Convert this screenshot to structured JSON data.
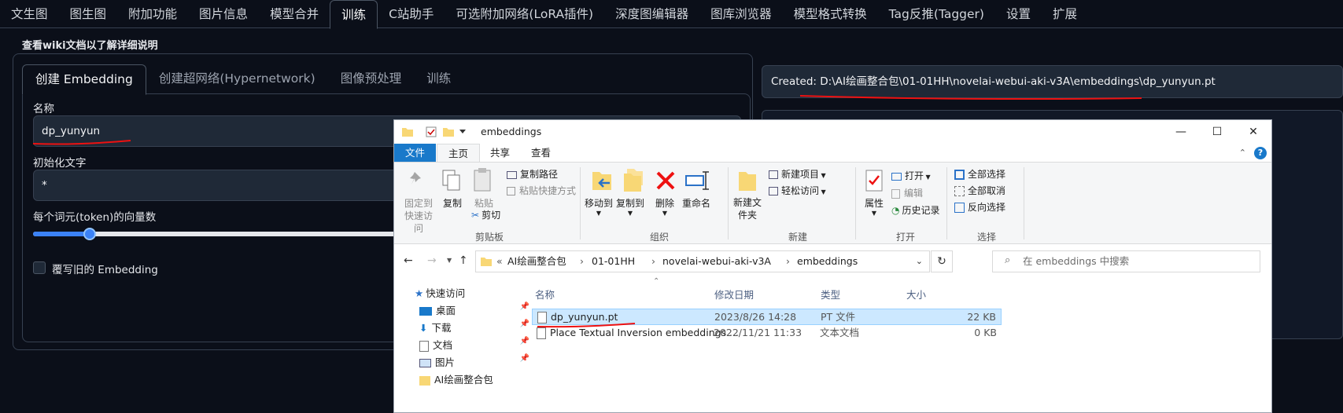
{
  "top_tabs": [
    "文生图",
    "图生图",
    "附加功能",
    "图片信息",
    "模型合并",
    "训练",
    "C站助手",
    "可选附加网络(LoRA插件)",
    "深度图编辑器",
    "图库浏览器",
    "模型格式转换",
    "Tag反推(Tagger)",
    "设置",
    "扩展"
  ],
  "wiki_link": "查看wiki文档以了解详细说明",
  "sub_tabs": [
    "创建 Embedding",
    "创建超网络(Hypernetwork)",
    "图像预处理",
    "训练"
  ],
  "form": {
    "name_label": "名称",
    "name_value": "dp_yunyun",
    "init_label": "初始化文字",
    "init_value": "*",
    "vectors_label": "每个词元(token)的向量数",
    "vectors_fraction": 0.15,
    "overwrite_label": "覆写旧的 Embedding"
  },
  "output_text": "Created: D:\\AI绘画整合包\\01-01HH\\novelai-webui-aki-v3A\\embeddings\\dp_yunyun.pt",
  "explorer": {
    "title": "embeddings",
    "ribbon_tabs": [
      "文件",
      "主页",
      "共享",
      "查看"
    ],
    "clipboard": {
      "pin": "固定到快速访问",
      "copy": "复制",
      "paste": "粘贴",
      "copy_path": "复制路径",
      "paste_shortcut": "粘贴快捷方式",
      "cut": "剪切",
      "group": "剪贴板"
    },
    "organize": {
      "move_to": "移动到",
      "copy_to": "复制到",
      "delete": "删除",
      "rename": "重命名",
      "group": "组织"
    },
    "new": {
      "new_folder": "新建文件夹",
      "new_item": "新建项目",
      "easy_access": "轻松访问",
      "group": "新建"
    },
    "open": {
      "properties": "属性",
      "open": "打开",
      "edit": "编辑",
      "history": "历史记录",
      "group": "打开"
    },
    "select": {
      "select_all": "全部选择",
      "select_none": "全部取消",
      "invert": "反向选择",
      "group": "选择"
    },
    "breadcrumb": [
      "«",
      "AI绘画整合包",
      "01-01HH",
      "novelai-webui-aki-v3A",
      "embeddings"
    ],
    "search_placeholder": "在 embeddings 中搜索",
    "nav_items": [
      "快速访问",
      "桌面",
      "下载",
      "文档",
      "图片",
      "AI绘画整合包"
    ],
    "columns": [
      "名称",
      "修改日期",
      "类型",
      "大小"
    ],
    "files": [
      {
        "name": "dp_yunyun.pt",
        "date": "2023/8/26 14:28",
        "type": "PT 文件",
        "size": "22 KB"
      },
      {
        "name": "Place Textual Inversion embeddings ...",
        "date": "2022/11/21 11:33",
        "type": "文本文档",
        "size": "0 KB"
      }
    ]
  }
}
